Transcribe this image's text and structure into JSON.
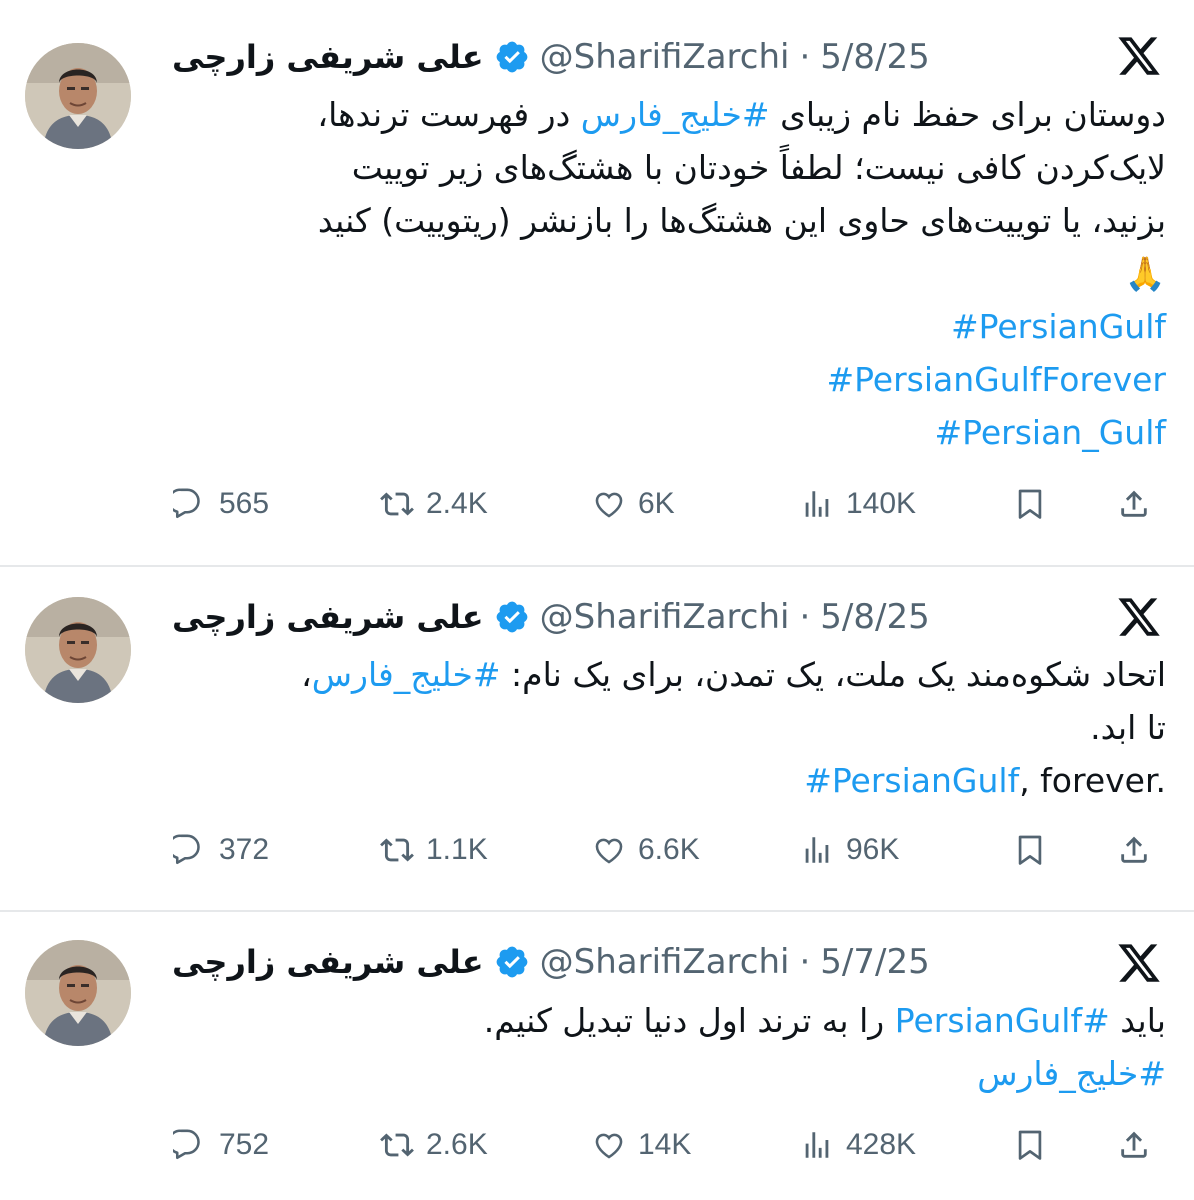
{
  "tweets": [
    {
      "author_name": "علی شریفی زارچی",
      "handle": "@SharifiZarchi",
      "separator": "·",
      "date": "5/8/25",
      "lines": [
        {
          "pre": "دوستان برای حفظ نام زیبای ",
          "tag": "#خلیج_فارس",
          "post": " در فهرست ترندها،"
        },
        {
          "text": "لایک‌کردن کافی نیست؛ لطفاً خودتان با هشتگ‌های زیر توییت"
        },
        {
          "text": "بزنید، یا توییت‌های حاوی این هشتگ‌ها را بازنشر (ریتوییت) کنید"
        },
        {
          "text": "🙏"
        },
        {
          "tag": "#PersianGulf"
        },
        {
          "tag": "#PersianGulfForever"
        },
        {
          "tag": "#Persian_Gulf"
        }
      ],
      "replies": "565",
      "reposts": "2.4K",
      "likes": "6K",
      "views": "140K"
    },
    {
      "author_name": "علی شریفی زارچی",
      "handle": "@SharifiZarchi",
      "separator": "·",
      "date": "5/8/25",
      "lines": [
        {
          "pre": "اتحاد شکوه‌مند یک ملت، یک تمدن، برای یک نام: ",
          "tag": "#خلیج_فارس",
          "post": "،"
        },
        {
          "text": "تا ابد."
        },
        {
          "tag": "#PersianGulf",
          "post": ", forever."
        }
      ],
      "replies": "372",
      "reposts": "1.1K",
      "likes": "6.6K",
      "views": "96K"
    },
    {
      "author_name": "علی شریفی زارچی",
      "handle": "@SharifiZarchi",
      "separator": "·",
      "date": "5/7/25",
      "lines": [
        {
          "pre": "باید ",
          "tag": "#PersianGulf",
          "post": " را به ترند اول دنیا تبدیل کنیم."
        },
        {
          "tag": "#خلیج_فارس"
        }
      ],
      "replies": "752",
      "reposts": "2.6K",
      "likes": "14K",
      "views": "428K"
    }
  ],
  "icons": {
    "verified": "verified-badge-icon",
    "platform": "x-logo-icon",
    "reply": "reply-icon",
    "repost": "repost-icon",
    "like": "heart-icon",
    "views": "views-icon",
    "bookmark": "bookmark-icon",
    "share": "share-icon"
  },
  "colors": {
    "link": "#1d9bf0",
    "text": "#0f1419",
    "muted": "#536471",
    "divider": "#e6e8ea"
  }
}
